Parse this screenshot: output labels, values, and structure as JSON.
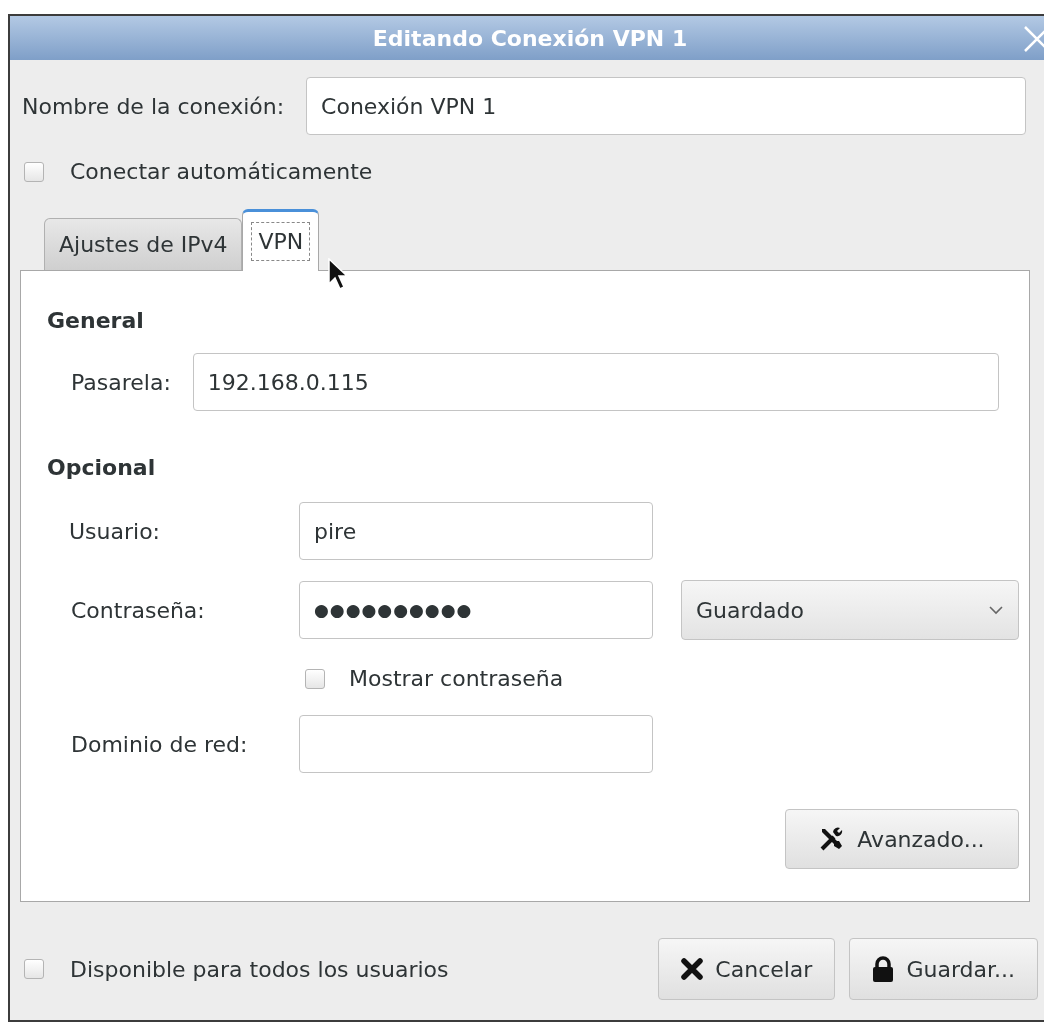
{
  "window": {
    "title": "Editando Conexión VPN 1"
  },
  "connection_name": {
    "label": "Nombre de la conexión:",
    "value": "Conexión VPN 1"
  },
  "auto_connect": {
    "label": "Conectar automáticamente",
    "checked": false
  },
  "tabs": [
    {
      "label": "Ajustes de IPv4",
      "selected": false
    },
    {
      "label": "VPN",
      "selected": true
    }
  ],
  "general": {
    "heading": "General",
    "gateway": {
      "label": "Pasarela:",
      "value": "192.168.0.115"
    }
  },
  "optional": {
    "heading": "Opcional",
    "user": {
      "label": "Usuario:",
      "value": "pire"
    },
    "password": {
      "label": "Contraseña:",
      "value": "●●●●●●●●●●",
      "storage": "Guardado"
    },
    "show_password": {
      "label": "Mostrar contraseña",
      "checked": false
    },
    "domain": {
      "label": "Dominio de red:"
    }
  },
  "advanced_button": "Avanzado...",
  "all_users": {
    "label": "Disponible para todos los usuarios",
    "checked": false
  },
  "buttons": [
    {
      "kind": "cancel",
      "label": "Cancelar"
    },
    {
      "kind": "save",
      "label": "Guardar..."
    }
  ]
}
